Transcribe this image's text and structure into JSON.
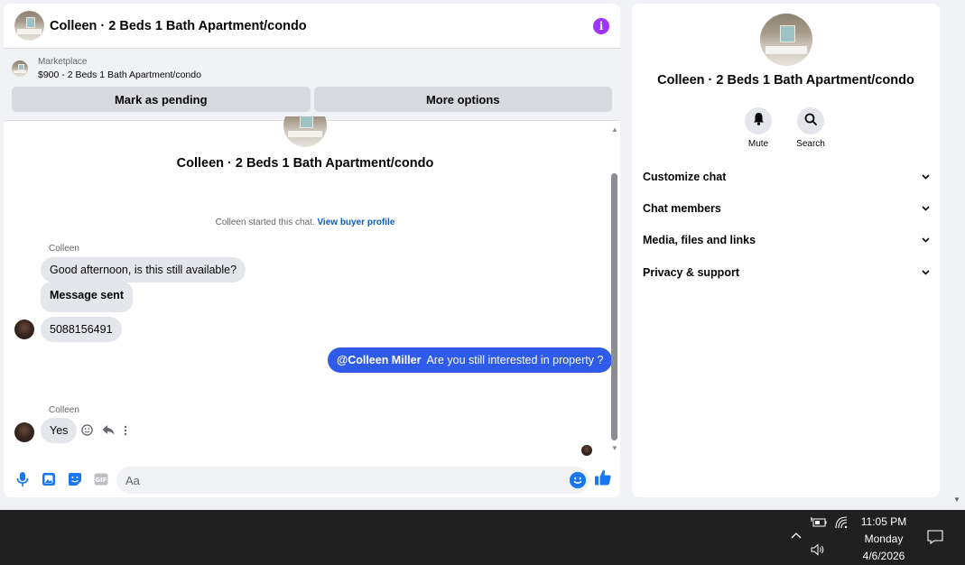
{
  "chat": {
    "header_title": "Colleen · 2 Beds 1 Bath Apartment/condo",
    "marketplace_label": "Marketplace",
    "marketplace_listing": "$900 - 2 Beds 1 Bath Apartment/condo",
    "mark_pending_label": "Mark as pending",
    "more_options_label": "More options",
    "thread_name": "Colleen · 2 Beds 1 Bath Apartment/condo",
    "started_text": "Colleen started this chat.",
    "view_profile_link": "View buyer profile",
    "messages": [
      {
        "sender": "Colleen",
        "text": "Good afternoon, is this still available?"
      },
      {
        "text": "Message sent"
      },
      {
        "text": "5088156491"
      },
      {
        "mention": "@Colleen Miller",
        "text": "Are you still interested in property ?"
      },
      {
        "sender": "Colleen",
        "text": "Yes"
      }
    ],
    "composer_placeholder": "Aa"
  },
  "info": {
    "name": "Colleen · 2 Beds 1 Bath Apartment/condo",
    "mute_label": "Mute",
    "search_label": "Search",
    "sections": [
      "Customize chat",
      "Chat members",
      "Media, files and links",
      "Privacy & support"
    ]
  },
  "taskbar": {
    "time": "11:05 PM",
    "day": "Monday",
    "date": "4/6/2026"
  },
  "colors": {
    "accent": "#2f5bea",
    "messenger_blue": "#1877f2",
    "info_purple": "#a033ff",
    "bubble_gray": "#e4e6eb"
  }
}
